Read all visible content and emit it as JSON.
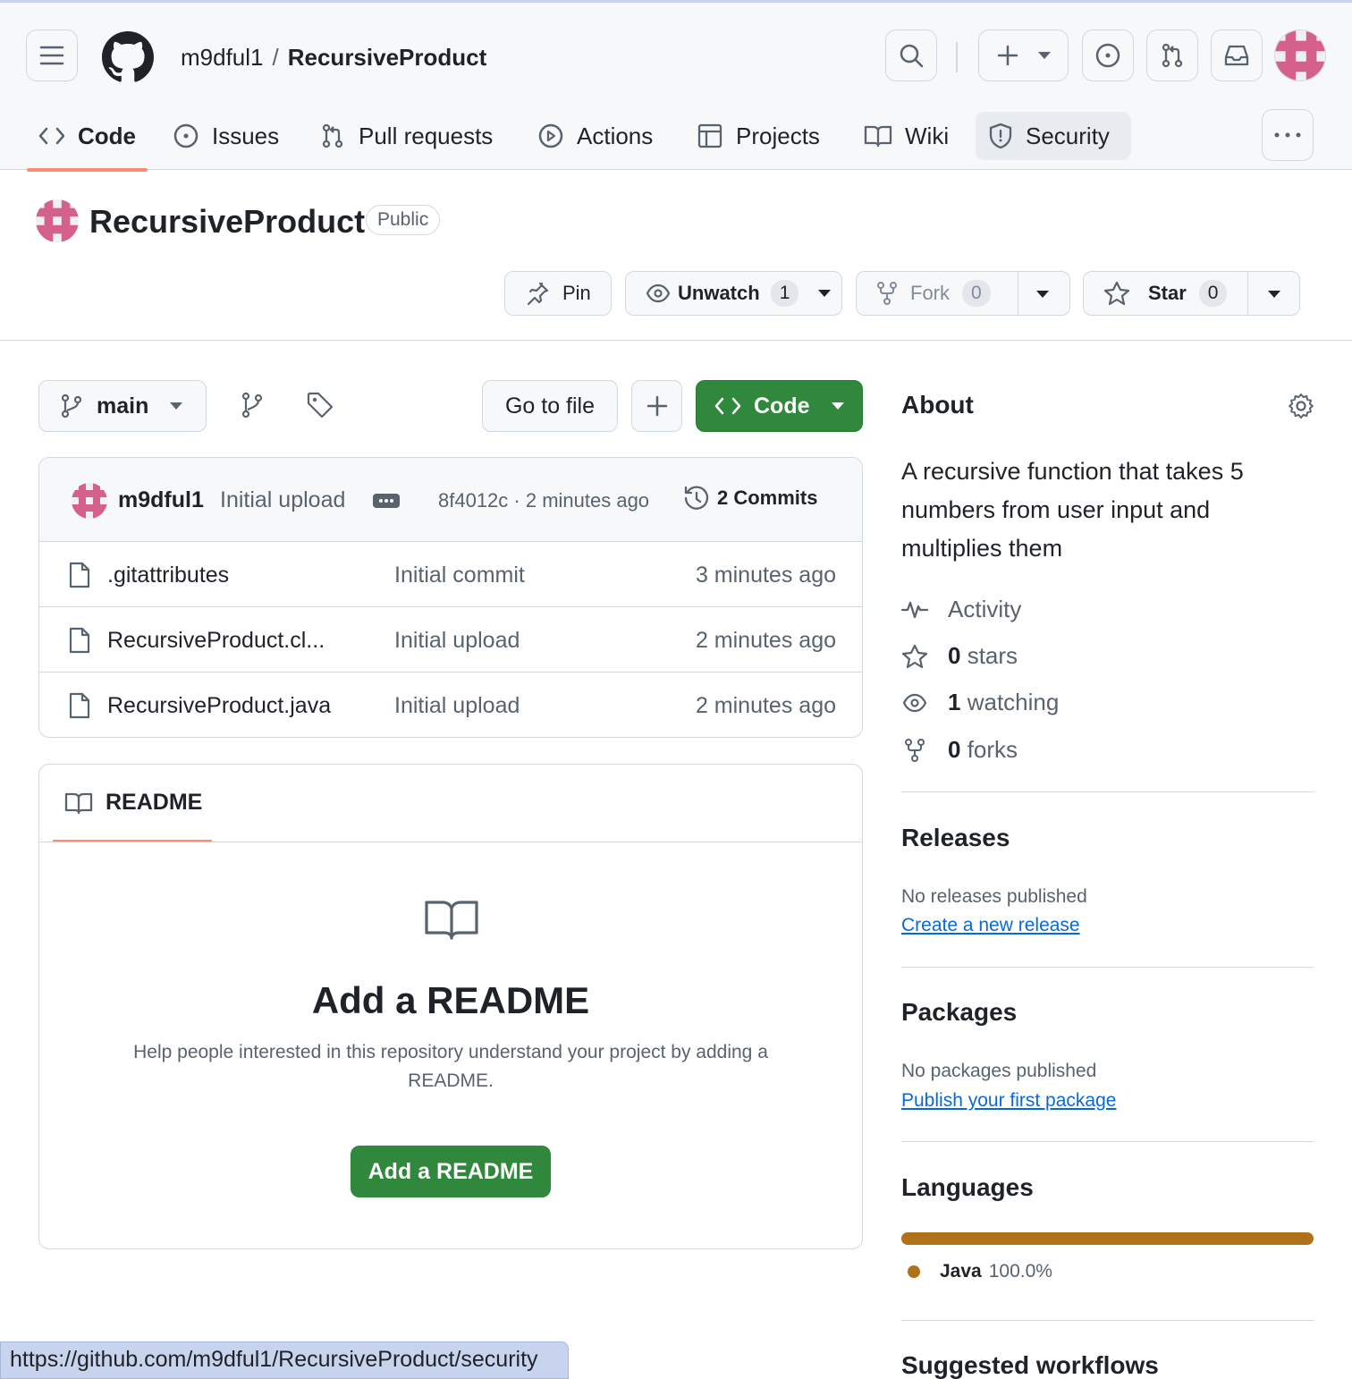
{
  "header": {
    "owner": "m9dful1",
    "separator": "/",
    "repo": "RecursiveProduct",
    "tabs": [
      {
        "label": "Code",
        "icon": "code-icon"
      },
      {
        "label": "Issues",
        "icon": "issue-icon"
      },
      {
        "label": "Pull requests",
        "icon": "pull-request-icon"
      },
      {
        "label": "Actions",
        "icon": "play-icon"
      },
      {
        "label": "Projects",
        "icon": "table-icon"
      },
      {
        "label": "Wiki",
        "icon": "book-icon"
      },
      {
        "label": "Security",
        "icon": "shield-icon"
      }
    ]
  },
  "repo": {
    "name": "RecursiveProduct",
    "visibility": "Public",
    "pin_label": "Pin",
    "unwatch_label": "Unwatch",
    "watch_count": "1",
    "fork_label": "Fork",
    "fork_count": "0",
    "star_label": "Star",
    "star_count": "0"
  },
  "toolbar": {
    "branch": "main",
    "goto_file": "Go to file",
    "code_label": "Code"
  },
  "commit": {
    "author": "m9dful1",
    "message": "Initial upload",
    "meta": "8f4012c · 2 minutes ago",
    "commits_label": "2 Commits"
  },
  "files": [
    {
      "name": ".gitattributes",
      "message": "Initial commit",
      "time": "3 minutes ago"
    },
    {
      "name": "RecursiveProduct.cl...",
      "message": "Initial upload",
      "time": "2 minutes ago"
    },
    {
      "name": "RecursiveProduct.java",
      "message": "Initial upload",
      "time": "2 minutes ago"
    }
  ],
  "readme": {
    "tab_label": "README",
    "title": "Add a README",
    "description": "Help people interested in this repository understand your project by adding a README.",
    "button": "Add a README"
  },
  "about": {
    "title": "About",
    "description": "A recursive function that takes 5 numbers from user input and multiplies them",
    "activity": "Activity",
    "stars_count": "0",
    "stars_label": "stars",
    "watching_count": "1",
    "watching_label": "watching",
    "forks_count": "0",
    "forks_label": "forks"
  },
  "releases": {
    "title": "Releases",
    "empty": "No releases published",
    "link": "Create a new release"
  },
  "packages": {
    "title": "Packages",
    "empty": "No packages published",
    "link": "Publish your first package"
  },
  "languages": {
    "title": "Languages",
    "items": [
      {
        "name": "Java",
        "percent": "100.0%",
        "color": "#b07219"
      }
    ]
  },
  "workflows": {
    "title": "Suggested workflows"
  },
  "status_url": "https://github.com/m9dful1/RecursiveProduct/security",
  "colors": {
    "accent_green": "#2f883b",
    "tab_underline": "#fd8c73",
    "link_blue": "#0969da",
    "avatar_pink": "#d6608c"
  }
}
